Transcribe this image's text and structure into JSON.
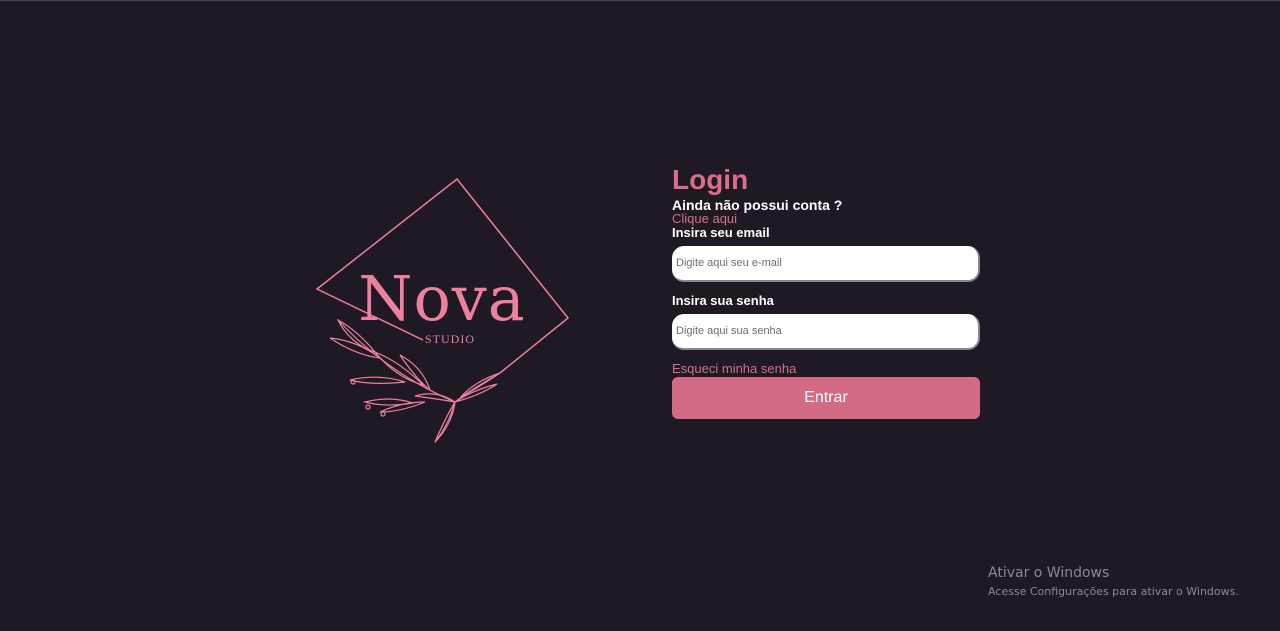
{
  "brand": {
    "name": "Nova",
    "sub": "STUDIO"
  },
  "login": {
    "title": "Login",
    "no_account_text": "Ainda não possui conta ?",
    "signup_link": "Clique aqui",
    "email_label": "Insira seu email",
    "email_placeholder": "Digite aqui seu e-mail",
    "password_label": "Insira sua senha",
    "password_placeholder": "Digite aqui sua senha",
    "forgot_link": "Esqueci minha senha",
    "submit_label": "Entrar"
  },
  "windows_watermark": {
    "title": "Ativar o Windows",
    "subtitle": "Acesse Configurações para ativar o Windows."
  },
  "colors": {
    "background": "#1e1922",
    "accent": "#d96d8a",
    "logo": "#ee7f9e",
    "button": "#d46b84"
  },
  "icons": {
    "logo_decoration": "leaf-branch-icon"
  }
}
